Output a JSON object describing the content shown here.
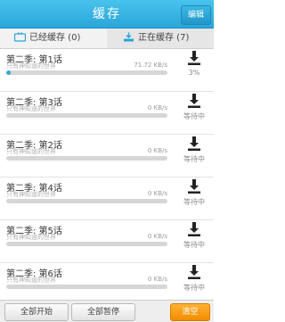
{
  "header": {
    "title": "缓存",
    "edit_label": "编辑"
  },
  "tabs": {
    "downloaded_label": "已经缓存 (0)",
    "downloading_label": "正在缓存 (7)"
  },
  "items": [
    {
      "title": "第二季: 第1话",
      "subtitle": "只有神知道的世界",
      "speed": "71.72 KB/s",
      "status": "3%",
      "progress": 0.03
    },
    {
      "title": "第二季: 第3话",
      "subtitle": "只有神知道的世界",
      "speed": "0 KB/s",
      "status": "等待中",
      "progress": 0
    },
    {
      "title": "第二季: 第2话",
      "subtitle": "只有神知道的世界",
      "speed": "0 KB/s",
      "status": "等待中",
      "progress": 0
    },
    {
      "title": "第二季: 第4话",
      "subtitle": "只有神知道的世界",
      "speed": "0 KB/s",
      "status": "等待中",
      "progress": 0
    },
    {
      "title": "第二季: 第5话",
      "subtitle": "只有神知道的世界",
      "speed": "0 KB/s",
      "status": "等待中",
      "progress": 0
    },
    {
      "title": "第二季: 第6话",
      "subtitle": "只有神知道的世界",
      "speed": "0 KB/s",
      "status": "等待中",
      "progress": 0
    }
  ],
  "footer": {
    "start_all": "全部开始",
    "pause_all": "全部暂停",
    "clear": "清空"
  },
  "colors": {
    "header": "#2aa6d8",
    "progress": "#3aa2d8",
    "clear_button": "#f28c00"
  }
}
